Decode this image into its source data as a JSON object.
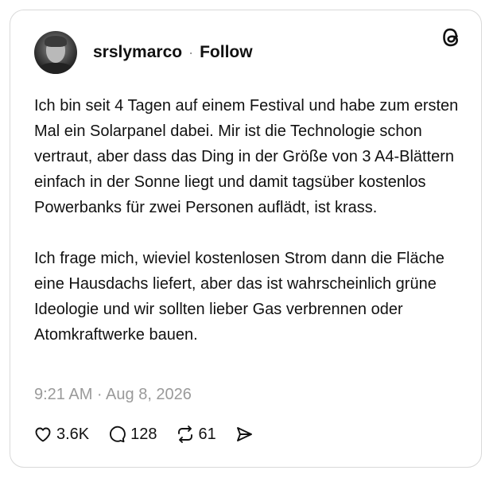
{
  "post": {
    "username": "srslymarco",
    "separator": "·",
    "follow_label": "Follow",
    "paragraphs": [
      "Ich bin seit 4 Tagen auf einem Festival und habe zum ersten Mal ein Solarpanel dabei. Mir ist die Technologie schon vertraut, aber dass das Ding in der Größe von 3 A4-Blättern einfach in der Sonne liegt und damit tagsüber kostenlos Powerbanks für zwei Personen auflädt, ist krass.",
      "Ich frage mich, wieviel kostenlosen Strom dann die Fläche eine Hausdachs liefert, aber das ist wahrscheinlich grüne Ideologie und wir sollten lieber Gas verbrennen oder Atomkraftwerke bauen."
    ],
    "timestamp": "9:21 AM · Aug 8, 2026"
  },
  "actions": {
    "likes": "3.6K",
    "replies": "128",
    "reposts": "61"
  },
  "icons": {
    "logo": "threads-logo-icon",
    "like": "heart-icon",
    "reply": "speech-bubble-icon",
    "repost": "repost-arrows-icon",
    "share": "send-icon"
  }
}
